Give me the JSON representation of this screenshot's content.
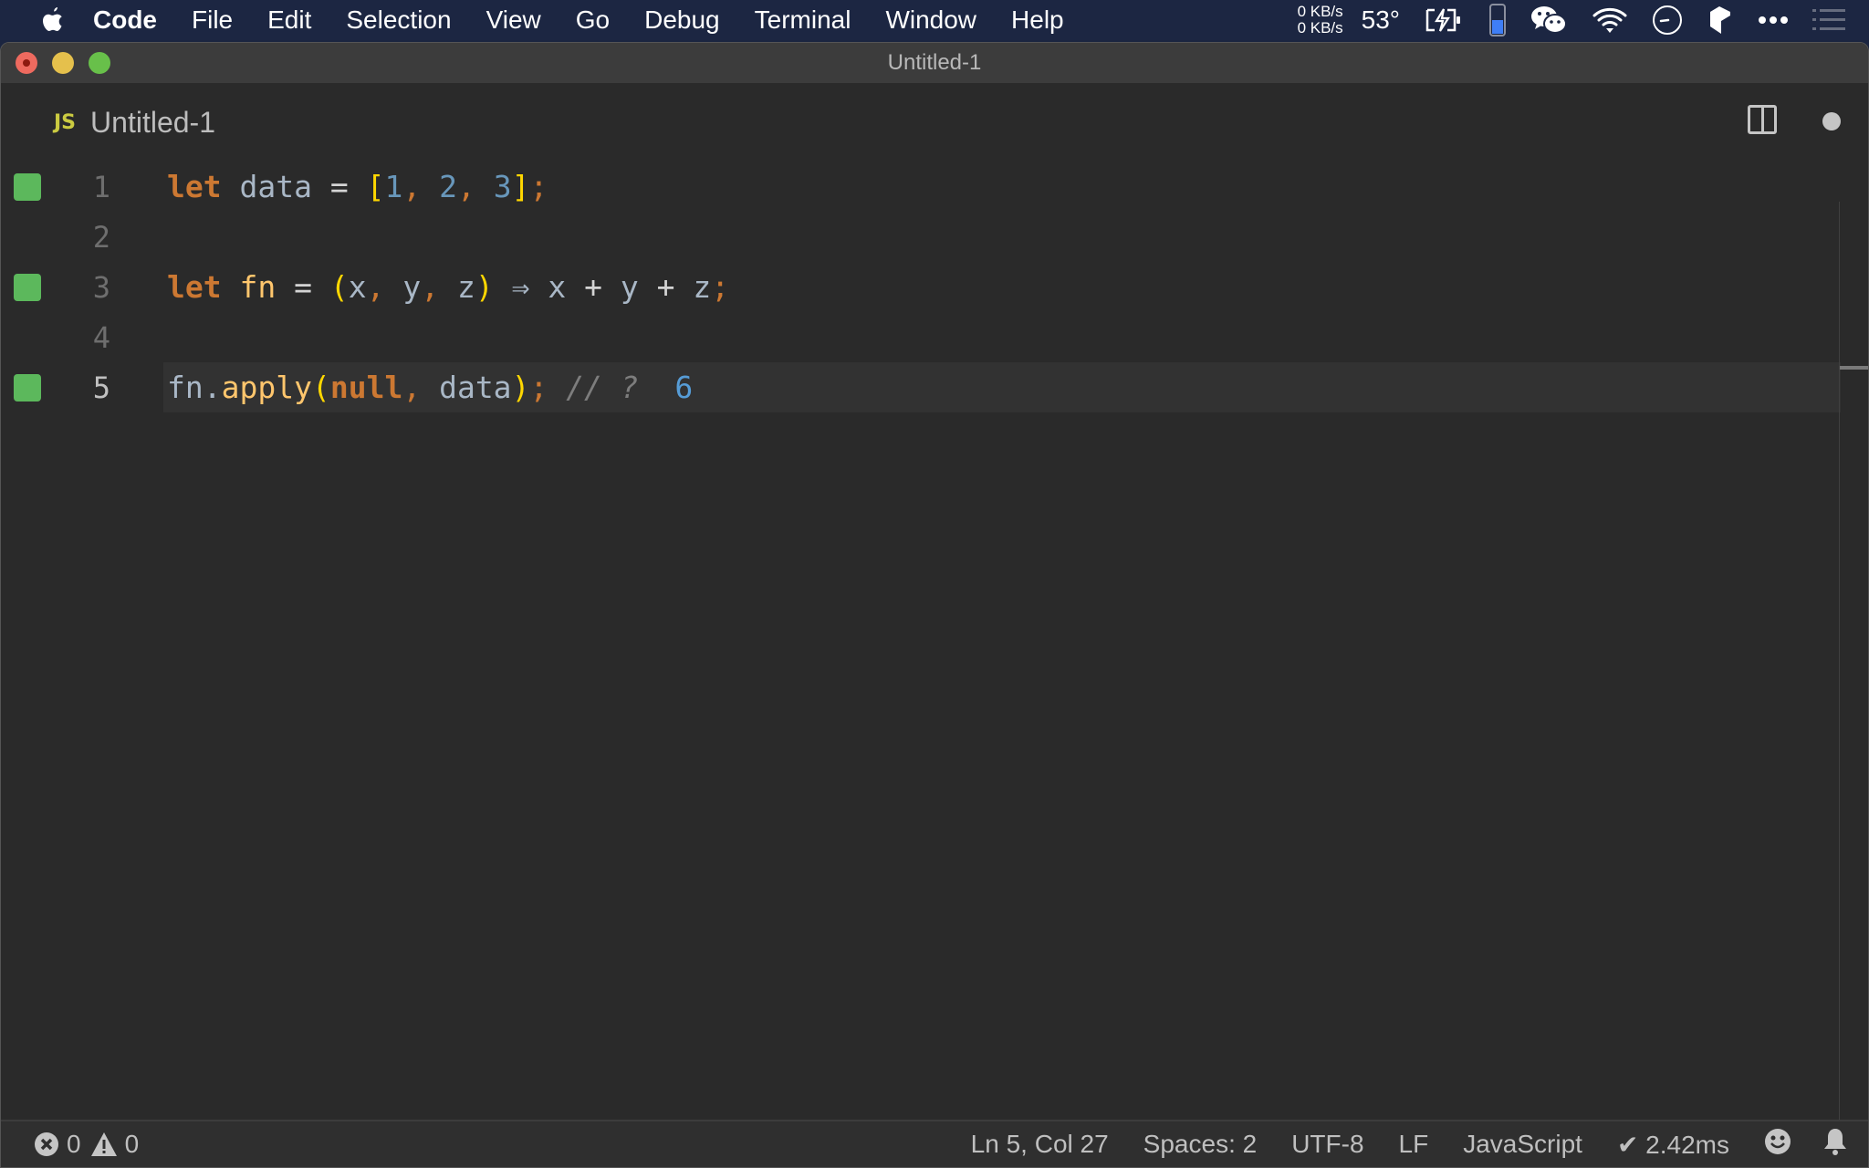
{
  "menubar": {
    "app_name": "Code",
    "items": [
      "File",
      "Edit",
      "Selection",
      "View",
      "Go",
      "Debug",
      "Terminal",
      "Window",
      "Help"
    ],
    "net_up": "0 KB/s",
    "net_down": "0 KB/s",
    "temperature": "53°",
    "battery_level_fraction": 0.5
  },
  "window": {
    "title": "Untitled-1"
  },
  "tab": {
    "icon_label": "JS",
    "label": "Untitled-1",
    "dirty": true
  },
  "editor": {
    "current_line": 5,
    "lines": [
      {
        "number": "1",
        "covered": true
      },
      {
        "number": "2",
        "covered": false
      },
      {
        "number": "3",
        "covered": true
      },
      {
        "number": "4",
        "covered": false
      },
      {
        "number": "5",
        "covered": true
      }
    ],
    "code": {
      "l1": {
        "kw": "let",
        "ident": "data",
        "eq": "=",
        "open": "[",
        "n1": "1",
        "c1": ",",
        "n2": "2",
        "c2": ",",
        "n3": "3",
        "close": "]",
        "semi": ";"
      },
      "l3": {
        "kw": "let",
        "ident": "fn",
        "eq": "=",
        "open": "(",
        "p1": "x",
        "c1": ",",
        "p2": "y",
        "c2": ",",
        "p3": "z",
        "close": ")",
        "arrow": "⇒",
        "b1": "x",
        "plus1": "+",
        "b2": "y",
        "plus2": "+",
        "b3": "z",
        "semi": ";"
      },
      "l5": {
        "obj": "fn",
        "dot": ".",
        "method": "apply",
        "open": "(",
        "arg1": "null",
        "c1": ",",
        "arg2": "data",
        "close": ")",
        "semi": ";",
        "comment": "// ?",
        "result": "6"
      }
    }
  },
  "statusbar": {
    "errors": "0",
    "warnings": "0",
    "position": "Ln 5, Col 27",
    "indent": "Spaces: 2",
    "encoding": "UTF-8",
    "eol": "LF",
    "language": "JavaScript",
    "timing": "✔ 2.42ms"
  }
}
